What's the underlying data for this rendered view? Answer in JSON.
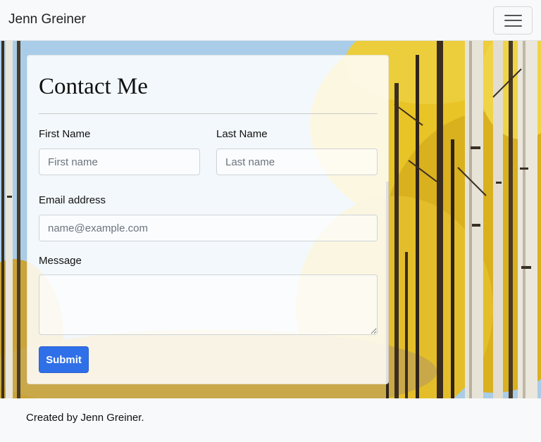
{
  "navbar": {
    "brand": "Jenn Greiner",
    "toggler_icon": "hamburger-menu-icon"
  },
  "hero": {
    "background": "aspen-forest-photo",
    "colors": {
      "sky": "#9ec8ea",
      "foliage": "#e7c229",
      "trunk": "#e6e2d6"
    }
  },
  "contact": {
    "title": "Contact Me",
    "first_name": {
      "label": "First Name",
      "placeholder": "First name",
      "value": ""
    },
    "last_name": {
      "label": "Last Name",
      "placeholder": "Last name",
      "value": ""
    },
    "email": {
      "label": "Email address",
      "placeholder": "name@example.com",
      "value": ""
    },
    "message": {
      "label": "Message",
      "value": ""
    },
    "submit_label": "Submit"
  },
  "footer": {
    "text": "Created by Jenn Greiner."
  },
  "theme": {
    "primary": "#2f6fe8",
    "navbar_bg": "#f8f9fa"
  }
}
